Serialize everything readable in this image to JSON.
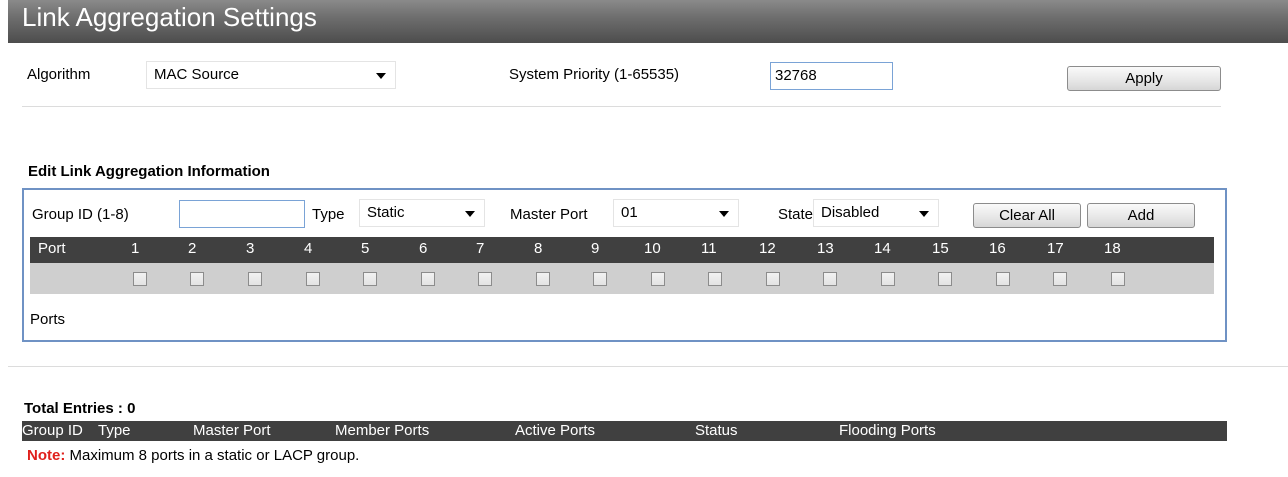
{
  "page": {
    "title": "Link Aggregation Settings"
  },
  "settings": {
    "algorithm_label": "Algorithm",
    "algorithm_value": "MAC Source",
    "priority_label": "System Priority (1-65535)",
    "priority_value": "32768",
    "apply_label": "Apply"
  },
  "edit": {
    "section_title": "Edit Link Aggregation Information",
    "group_id_label": "Group ID (1-8)",
    "group_id_value": "",
    "type_label": "Type",
    "type_value": "Static",
    "master_port_label": "Master Port",
    "master_port_value": "01",
    "state_label": "State",
    "state_value": "Disabled",
    "clear_all_label": "Clear All",
    "add_label": "Add",
    "port_label": "Port",
    "ports": [
      "1",
      "2",
      "3",
      "4",
      "5",
      "6",
      "7",
      "8",
      "9",
      "10",
      "11",
      "12",
      "13",
      "14",
      "15",
      "16",
      "17",
      "18"
    ],
    "ports_label": "Ports"
  },
  "entries": {
    "total_label": "Total Entries : 0",
    "columns": [
      "Group ID",
      "Type",
      "Master Port",
      "Member Ports",
      "Active Ports",
      "Status",
      "Flooding Ports"
    ]
  },
  "note": {
    "label": "Note:",
    "text": "Maximum 8 ports in a static or LACP group."
  },
  "colors": {
    "header_bar": "#404040",
    "note_red": "#e0201c",
    "box_border": "#6f92c4"
  }
}
